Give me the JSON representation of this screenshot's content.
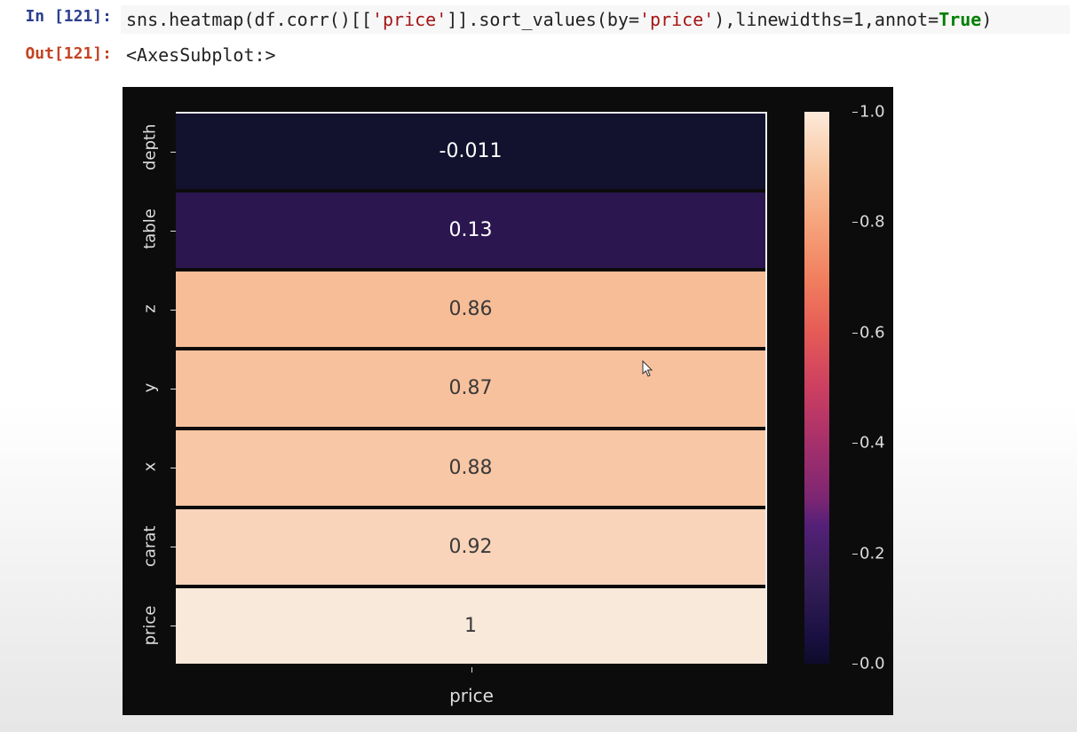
{
  "prompts": {
    "in": "In [121]:",
    "out": "Out[121]:"
  },
  "code": {
    "pre1": "sns.heatmap(df.corr()[[",
    "str1": "'price'",
    "mid1": "]].sort_values(by=",
    "str2": "'price'",
    "mid2": "),linewidths=",
    "num1": "1",
    "mid3": ",annot=",
    "kw1": "True",
    "post": ")"
  },
  "out_text": "<AxesSubplot:>",
  "heatmap": {
    "xlabel": "price",
    "rows": [
      {
        "label": "depth",
        "value": -0.011,
        "annot": "-0.011",
        "fill": "#12122e",
        "text": "#ffffff"
      },
      {
        "label": "table",
        "value": 0.13,
        "annot": "0.13",
        "fill": "#2b1650",
        "text": "#ffffff"
      },
      {
        "label": "z",
        "value": 0.86,
        "annot": "0.86",
        "fill": "#f7bd97",
        "text": "#3a3a3a"
      },
      {
        "label": "y",
        "value": 0.87,
        "annot": "0.87",
        "fill": "#f8c19d",
        "text": "#3a3a3a"
      },
      {
        "label": "x",
        "value": 0.88,
        "annot": "0.88",
        "fill": "#f8c7a5",
        "text": "#3a3a3a"
      },
      {
        "label": "carat",
        "value": 0.92,
        "annot": "0.92",
        "fill": "#f9d4ba",
        "text": "#3a3a3a"
      },
      {
        "label": "price",
        "value": 1,
        "annot": "1",
        "fill": "#f8e9db",
        "text": "#3a3a3a"
      }
    ]
  },
  "cbar_ticks": [
    {
      "v": "1.0",
      "pct": 0.0
    },
    {
      "v": "0.8",
      "pct": 0.2
    },
    {
      "v": "0.6",
      "pct": 0.4
    },
    {
      "v": "0.4",
      "pct": 0.6
    },
    {
      "v": "0.2",
      "pct": 0.8
    },
    {
      "v": "0.0",
      "pct": 1.0
    }
  ],
  "chart_data": {
    "type": "heatmap",
    "title": "",
    "xlabel": "price",
    "ylabel": "",
    "x": [
      "price"
    ],
    "y": [
      "depth",
      "table",
      "z",
      "y",
      "x",
      "carat",
      "price"
    ],
    "values": [
      [
        -0.011
      ],
      [
        0.13
      ],
      [
        0.86
      ],
      [
        0.87
      ],
      [
        0.88
      ],
      [
        0.92
      ],
      [
        1
      ]
    ],
    "annotations": [
      [
        "-0.011"
      ],
      [
        "0.13"
      ],
      [
        "0.86"
      ],
      [
        "0.87"
      ],
      [
        "0.88"
      ],
      [
        "0.92"
      ],
      [
        "1"
      ]
    ],
    "cmap": "rocket",
    "vmin": 0.0,
    "vmax": 1.0,
    "colorbar_ticks": [
      0.0,
      0.2,
      0.4,
      0.6,
      0.8,
      1.0
    ],
    "linewidths": 1,
    "annot": true
  }
}
